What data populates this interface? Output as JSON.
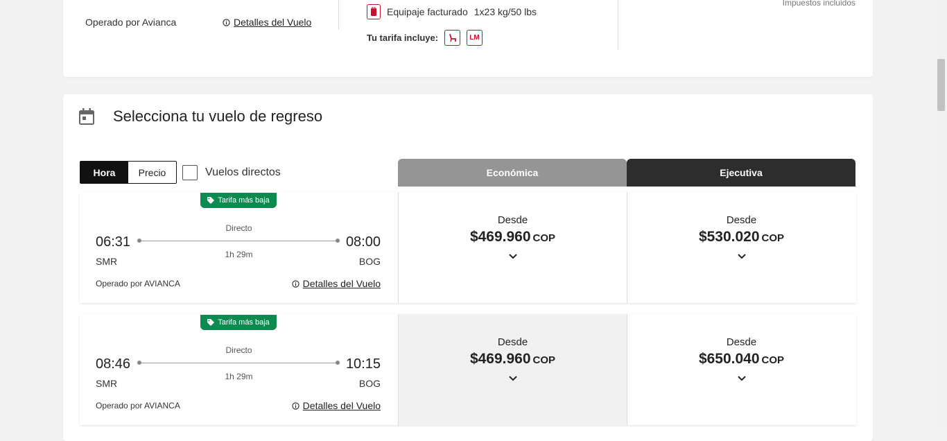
{
  "top_card": {
    "operated_by": "Operado por Avianca",
    "details_link": "Detalles del Vuelo",
    "baggage_label": "Equipaje facturado",
    "baggage_value": "1x23 kg/50 lbs",
    "fare_includes": "Tu tarifa incluye:",
    "fare_icon_seat": "seat-icon",
    "fare_icon_lm": "LM",
    "taxes_note": "Impuestos incluidos"
  },
  "section": {
    "title": "Selecciona tu vuelo de regreso",
    "sort_hora": "Hora",
    "sort_precio": "Precio",
    "direct_flights": "Vuelos directos",
    "cabin_economica": "Económica",
    "cabin_ejecutiva": "Ejecutiva"
  },
  "flights": [
    {
      "badge": "Tarifa más baja",
      "departure": "06:31",
      "arrival": "08:00",
      "origin": "SMR",
      "destination": "BOG",
      "stops": "Directo",
      "duration": "1h 29m",
      "operated_by": "Operado por AVIANCA",
      "details_link": "Detalles del Vuelo",
      "eco_from": "Desde",
      "eco_price": "$469.960",
      "eco_currency": "COP",
      "eje_from": "Desde",
      "eje_price": "$530.020",
      "eje_currency": "COP"
    },
    {
      "badge": "Tarifa más baja",
      "departure": "08:46",
      "arrival": "10:15",
      "origin": "SMR",
      "destination": "BOG",
      "stops": "Directo",
      "duration": "1h 29m",
      "operated_by": "Operado por AVIANCA",
      "details_link": "Detalles del Vuelo",
      "eco_from": "Desde",
      "eco_price": "$469.960",
      "eco_currency": "COP",
      "eje_from": "Desde",
      "eje_price": "$650.040",
      "eje_currency": "COP"
    }
  ],
  "colors": {
    "brand_red": "#c8102e",
    "badge_green": "#0c8a4f",
    "header_economica": "#959595",
    "header_ejecutiva": "#2d2d2d"
  }
}
